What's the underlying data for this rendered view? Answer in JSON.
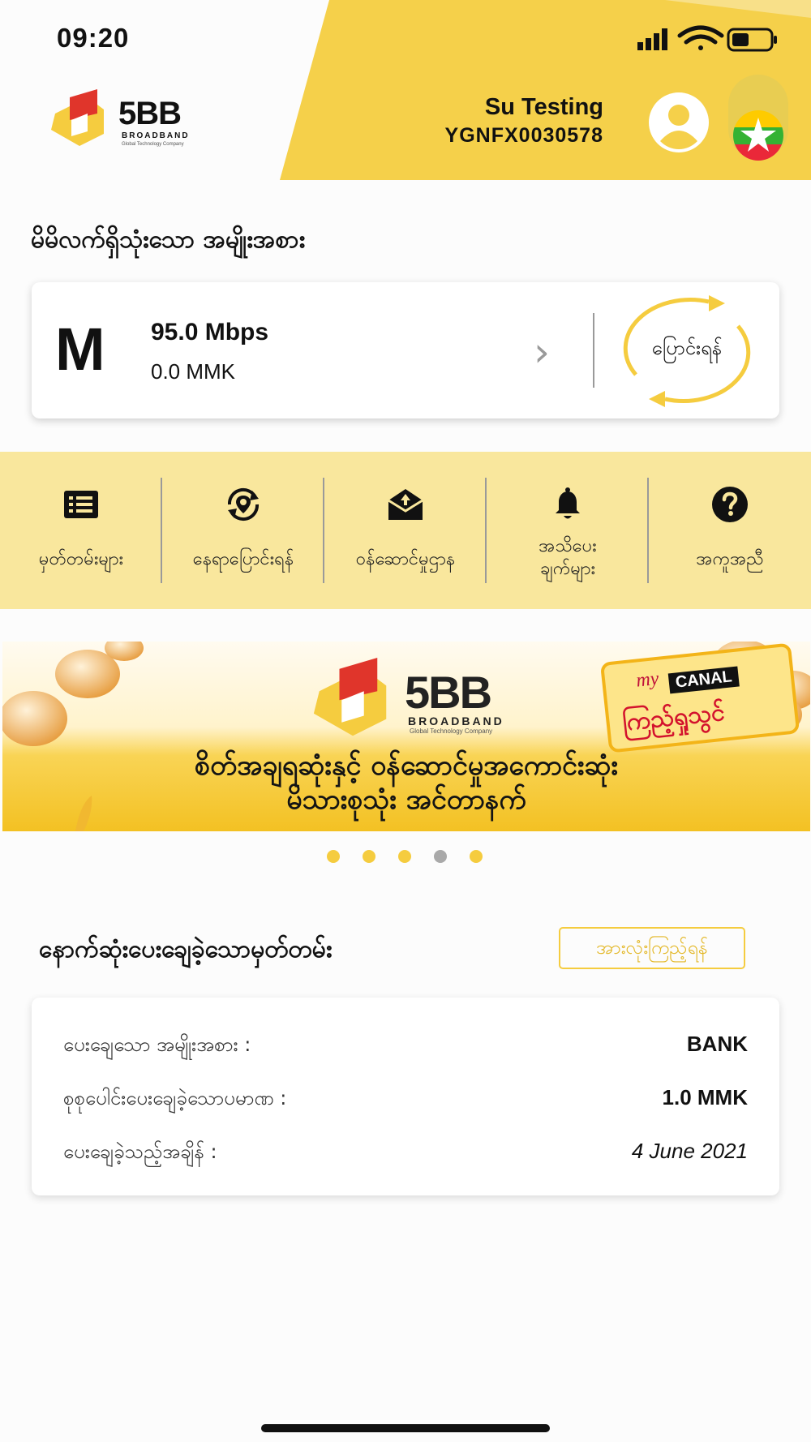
{
  "status_bar": {
    "time": "09:20"
  },
  "header": {
    "user_name": "Su Testing",
    "user_id": "YGNFX0030578",
    "logo_text": "5BB",
    "logo_sub": "BROADBAND",
    "logo_tagline": "Global Technology Company"
  },
  "current_plan": {
    "section_title": "မိမိလက်ရှိသုံးသော အမျိုးအစား",
    "plan_letter": "M",
    "speed": "95.0 Mbps",
    "price": "0.0 MMK",
    "chevron": "›",
    "change_label": "ပြောင်းရန်"
  },
  "quick_actions": [
    {
      "icon": "list-icon",
      "label": "မှတ်တမ်းများ"
    },
    {
      "icon": "relocate-icon",
      "label": "နေရာပြောင်းရန်"
    },
    {
      "icon": "service-center-icon",
      "label": "ဝန်ဆောင်မှုဌာန"
    },
    {
      "icon": "bell-icon",
      "label_line1": "အသိပေး",
      "label_line2": "ချက်များ"
    },
    {
      "icon": "help-icon",
      "label": "အကူအညီ"
    }
  ],
  "banner": {
    "logo_text": "5BB",
    "logo_sub": "BROADBAND",
    "logo_tagline": "Global Technology Company",
    "badge_top": "my",
    "badge_brand": "CANAL",
    "badge_bottom": "ကြည့်ရှုသွင်",
    "headline_line1": "စိတ်အချရဆုံးနှင့် ဝန်ဆောင်မှုအကောင်းဆုံး",
    "headline_line2": "မိသားစုသုံး အင်တာနက်",
    "slide_count": 5,
    "active_slide": 4
  },
  "payment_history": {
    "section_title": "နောက်ဆုံးပေးချေခဲ့သောမှတ်တမ်း",
    "view_all_label": "အားလုံးကြည့်ရန်",
    "rows": [
      {
        "label": "ပေးချေသော အမျိုးအစား :",
        "value": "BANK"
      },
      {
        "label": "စုစုပေါင်းပေးချေခဲ့သောပမာဏ :",
        "value": "1.0 MMK"
      },
      {
        "label": "ပေးချေခဲ့သည့်အချိန် :",
        "value": "4 June 2021"
      }
    ]
  },
  "colors": {
    "brand_yellow": "#f5d04a",
    "light_yellow": "#f9e79d",
    "logo_red": "#e0352b"
  }
}
